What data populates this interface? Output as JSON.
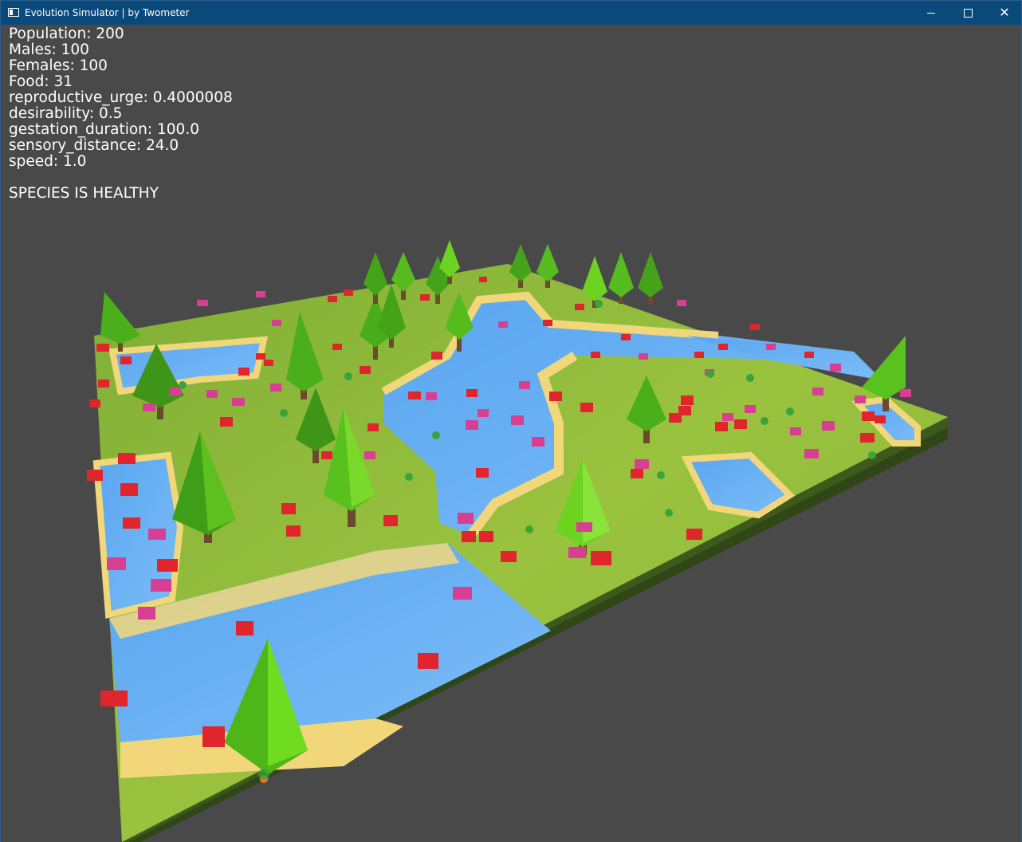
{
  "window": {
    "title": "Evolution Simulator | by Twometer",
    "icon": "app-window-icon",
    "controls": {
      "minimize": "minimize-icon",
      "maximize": "maximize-icon",
      "close": "✕"
    }
  },
  "stats": [
    "Population: 200",
    "Males: 100",
    "Females: 100",
    "Food: 31",
    "reproductive_urge: 0.4000008",
    "desirability: 0.5",
    "gestation_duration: 100.0",
    "sensory_distance: 24.0",
    "speed: 1.0"
  ],
  "status": "SPECIES IS HEALTHY",
  "colors": {
    "titlebar": "#0a4a7a",
    "background": "#494949",
    "grass": "#8fb93c",
    "sand": "#f2d77a",
    "water": "#72b4f5",
    "tree": "#5bbd1f",
    "male_creature": "#e0252d",
    "female_creature": "#d83f92"
  }
}
